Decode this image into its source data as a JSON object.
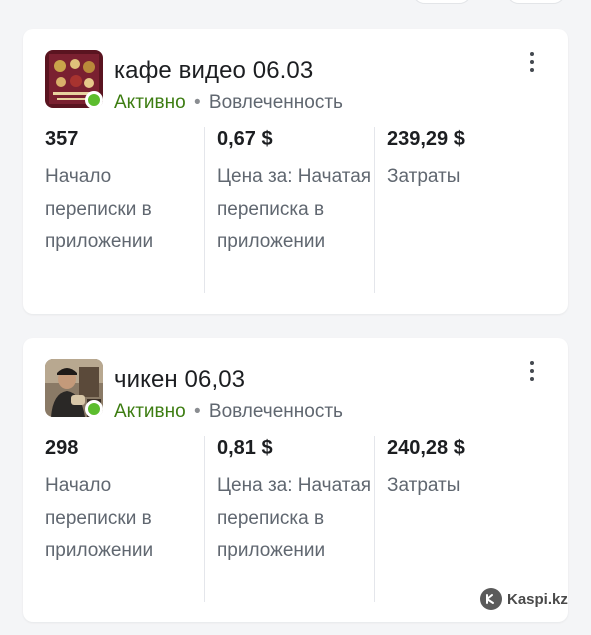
{
  "ads": [
    {
      "title": "кафе видео 06.03",
      "status": "Активно",
      "separator": "•",
      "objective": "Вовлеченность",
      "metrics": [
        {
          "value": "357",
          "label": "Начало переписки в приложении"
        },
        {
          "value": "0,67 $",
          "label": "Цена за: Начатая переписка в приложении"
        },
        {
          "value": "239,29 $",
          "label": "Затраты"
        }
      ]
    },
    {
      "title": "чикен 06,03",
      "status": "Активно",
      "separator": "•",
      "objective": "Вовлеченность",
      "metrics": [
        {
          "value": "298",
          "label": "Начало переписки в приложении"
        },
        {
          "value": "0,81 $",
          "label": "Цена за: Начатая переписка в приложении"
        },
        {
          "value": "240,28 $",
          "label": "Затраты"
        }
      ]
    }
  ],
  "watermark": {
    "text": "Kaspi.kz"
  },
  "colors": {
    "status_active": "#5cbd2e",
    "status_text": "#3d7d12",
    "card_bg": "#ffffff",
    "page_bg": "#f4f5f7"
  }
}
